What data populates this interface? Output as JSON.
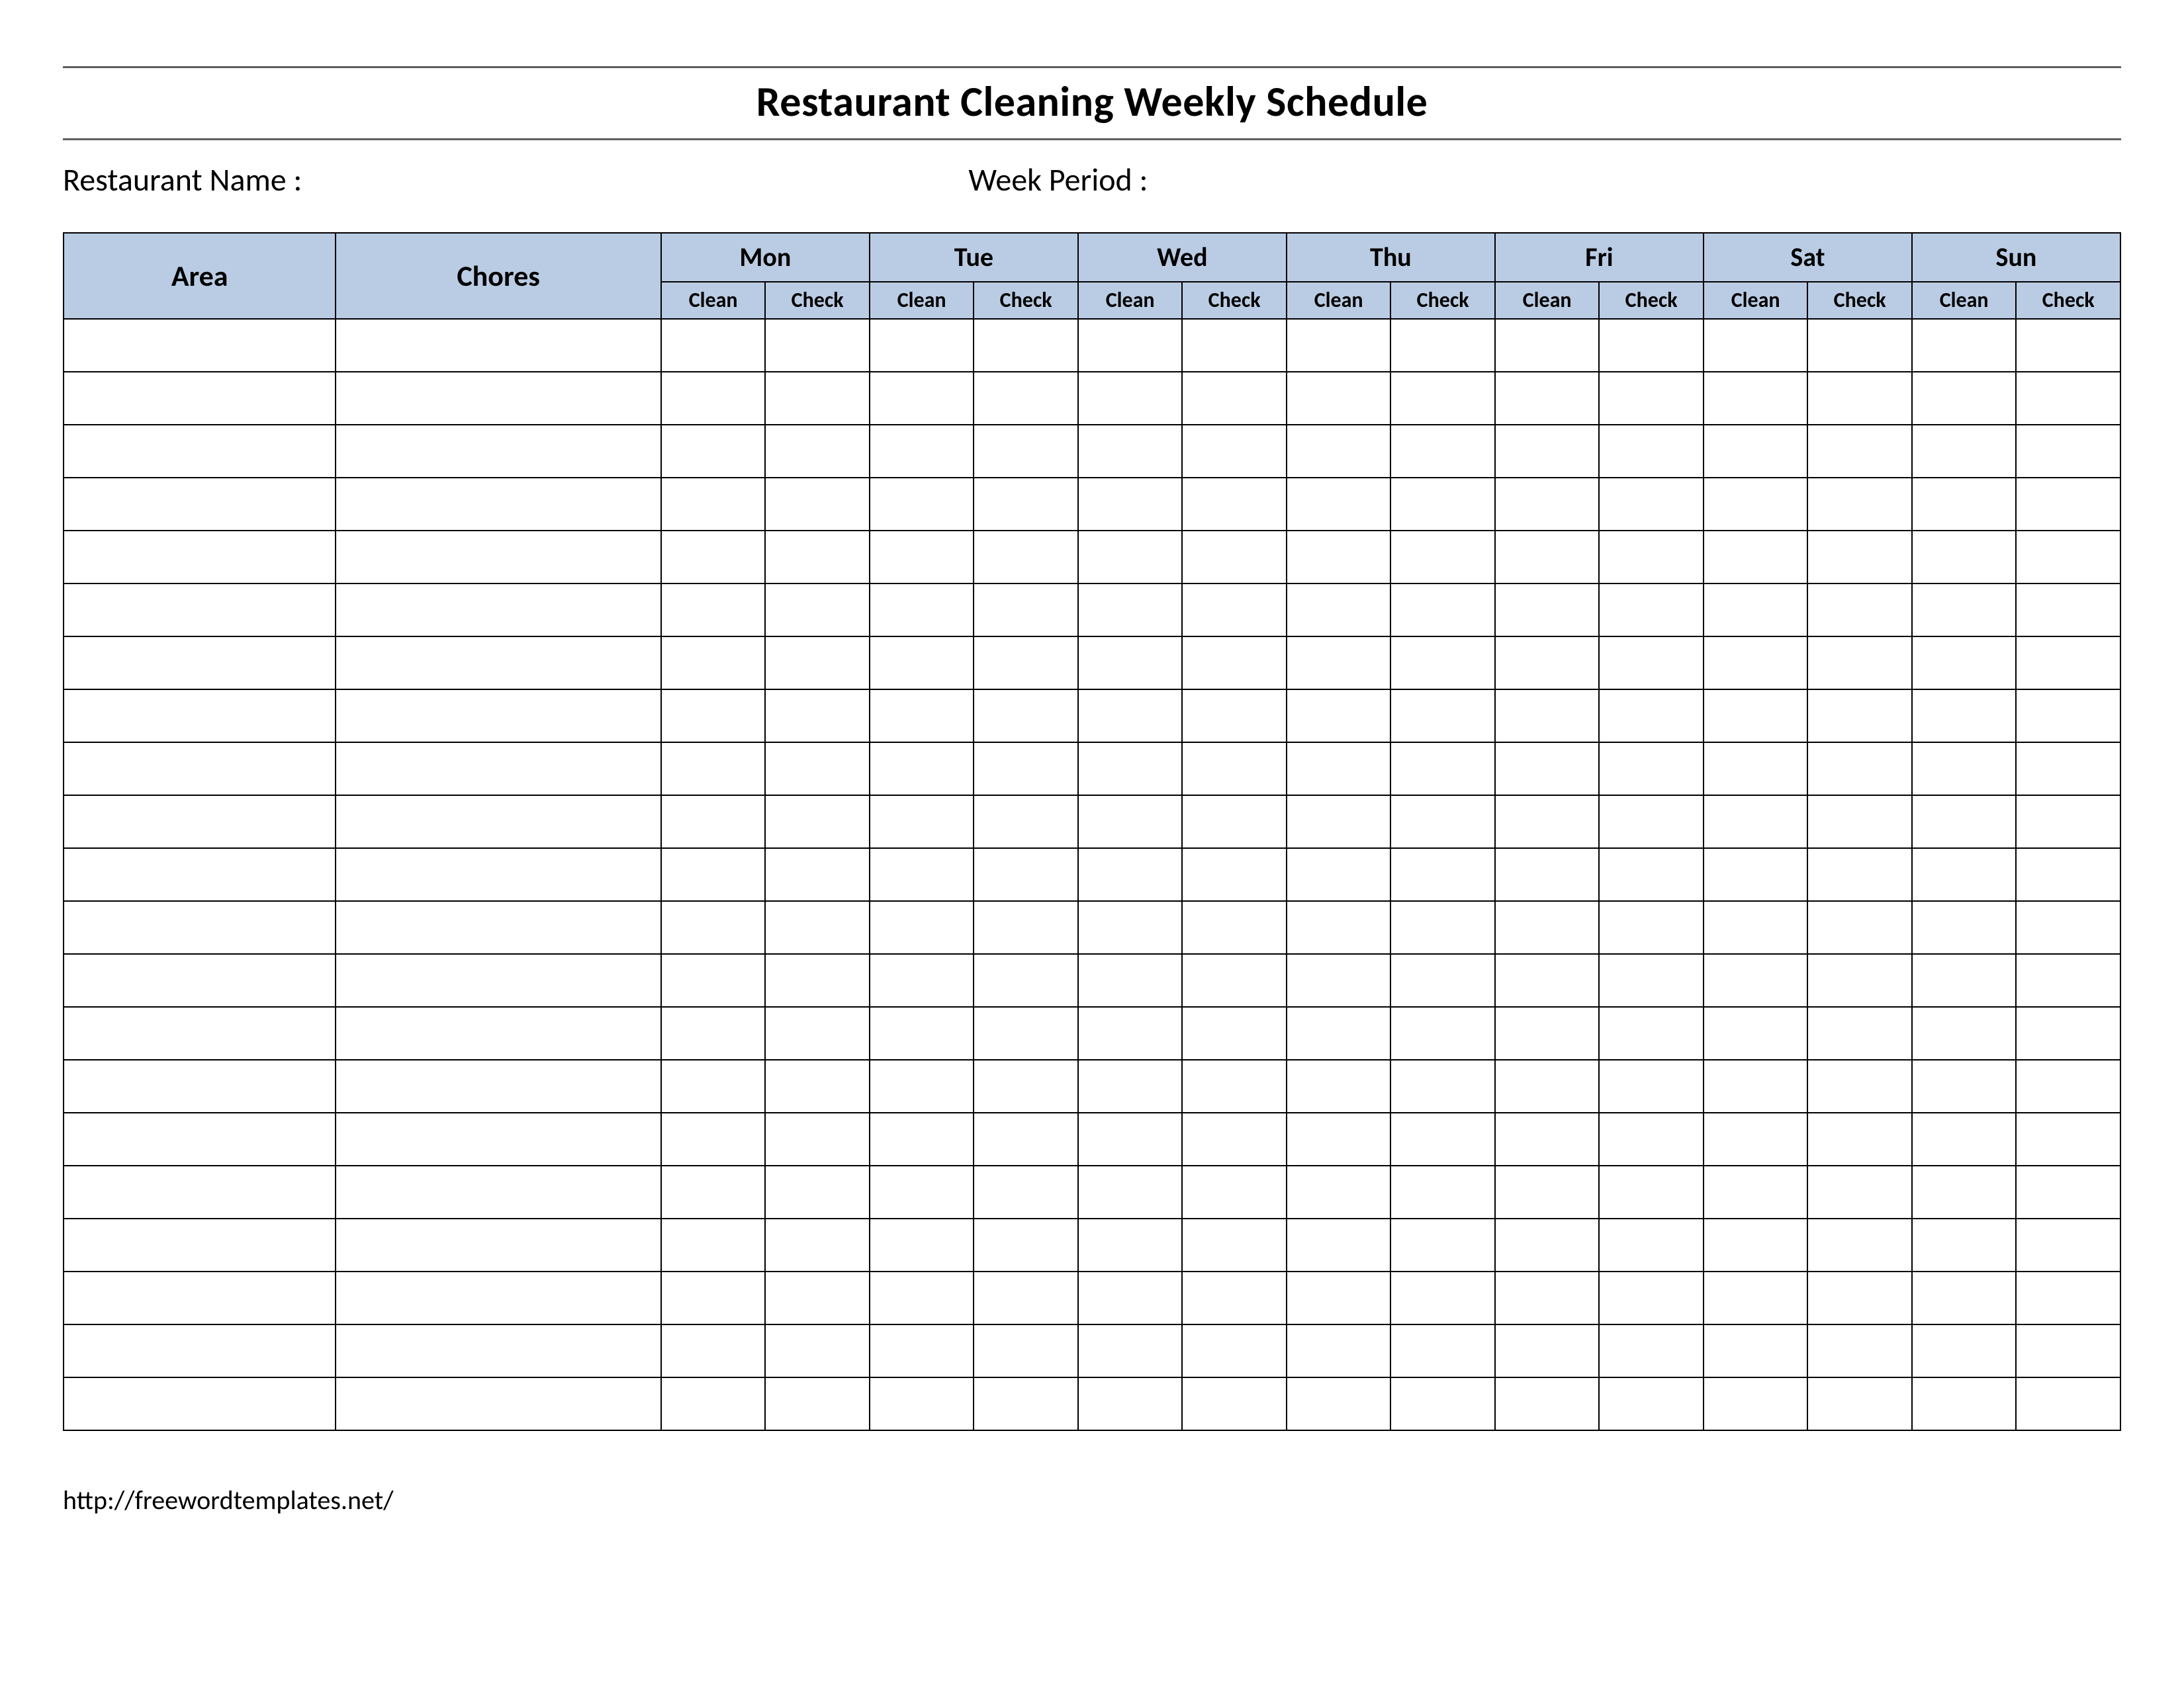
{
  "title": "Restaurant Cleaning Weekly Schedule",
  "meta": {
    "restaurant_name_label": "Restaurant Name   :",
    "week_period_label": "Week  Period :"
  },
  "columns": {
    "area": "Area",
    "chores": "Chores",
    "clean": "Clean",
    "check": "Check"
  },
  "days": [
    "Mon",
    "Tue",
    "Wed",
    "Thu",
    "Fri",
    "Sat",
    "Sun"
  ],
  "body_row_count": 21,
  "footer": {
    "url_text": "http://freewordtemplates.net/"
  },
  "colors": {
    "header_bg": "#bacce3",
    "border": "#000000",
    "rule": "#5e5e5e"
  }
}
